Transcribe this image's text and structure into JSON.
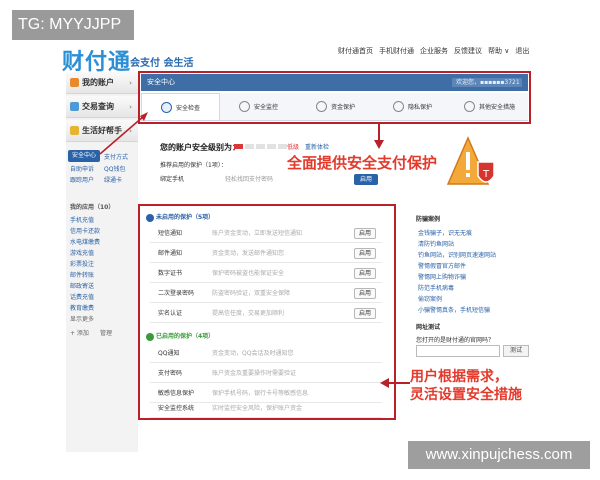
{
  "watermark_tl": "TG: MYYJJPP",
  "watermark_br": "www.xinpujchess.com",
  "logo": {
    "text": "财付通",
    "tagline": "会支付 会生活"
  },
  "topnav": [
    "财付通首页",
    "手机财付通",
    "企业服务",
    "反馈建议",
    "帮助 ∨",
    "退出"
  ],
  "sidebar": {
    "menus": [
      "我的账户",
      "交易查询",
      "生活好帮手"
    ],
    "security_active": "安全中心",
    "security_links": [
      "支付方式",
      "自助申诉",
      "QQ钱包",
      "跟踪用户",
      "绿通卡"
    ],
    "myapps_title": "我的应用（10）",
    "apps": [
      "手机充值",
      "信用卡还款",
      "水电煤缴费",
      "游戏充值",
      "彩票投注",
      "邮件转账",
      "邮政寄送",
      "话费充值",
      "教育缴费",
      "显示更多"
    ],
    "add": "+ 添加",
    "manage": "管理"
  },
  "header": {
    "title": "安全中心",
    "account": "欢迎您，▪▪▪▪▪▪3721"
  },
  "tabs": [
    "安全检查",
    "安全监控",
    "资金保护",
    "隐私保护",
    "其他安全措施"
  ],
  "level": {
    "title": "您的账户安全级别为：",
    "label": "低级",
    "link": "重新体检"
  },
  "recommend": {
    "title": "推荐启用的保护（1项）：",
    "name": "绑定手机",
    "desc": "轻松找回支付密码",
    "btn": "启用"
  },
  "banner": "全面提供安全支付保护",
  "sections": {
    "off_title": "未启用的保护（5项）",
    "off_items": [
      {
        "name": "短信通知",
        "desc": "账户资金变动，立即发送短信通知",
        "btn": "启用"
      },
      {
        "name": "邮件通知",
        "desc": "资金变动，发送邮件通知您",
        "btn": "启用"
      },
      {
        "name": "数字证书",
        "desc": "保护密码被盗也能保证安全",
        "btn": "启用"
      },
      {
        "name": "二次登录密码",
        "desc": "防盗密码验证，双重安全保障",
        "btn": "启用"
      },
      {
        "name": "实名认证",
        "desc": "提高信任度，交易更加顺利",
        "btn": "启用"
      }
    ],
    "on_title": "已启用的保护（4项）",
    "on_items": [
      {
        "name": "QQ通知",
        "desc": "资金变动，QQ会话及时通知您"
      },
      {
        "name": "支付密码",
        "desc": "账户资金及重要操作时需要验证"
      },
      {
        "name": "敏感信息保护",
        "desc": "保护手机号码，银行卡号等敏感信息"
      },
      {
        "name": "安全监控系统",
        "desc": "实时监控安全风险，保护账户资金"
      }
    ]
  },
  "right": {
    "title": "防骗案例",
    "links": [
      "金钱骗子，识无无痕",
      "清防钓鱼网站",
      "钓鱼网站，识别网页速速网站",
      "警惕假冒官方邮件",
      "警惕网上购物诈骗",
      "防范手机病毒",
      "偷窃案例",
      "小骗警惕真条，手机短信骗"
    ],
    "net_title": "网址测试",
    "net_q": "您打开的是财付通的官网吗？",
    "net_btn": "测试"
  },
  "note": [
    "用户根据需求，",
    "灵活设置安全措施"
  ]
}
